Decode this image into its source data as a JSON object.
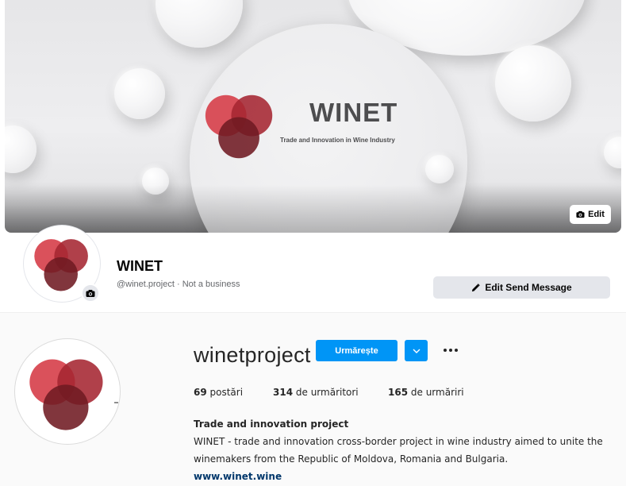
{
  "cover": {
    "title": "WINET",
    "tagline": "Trade and Innovation in Wine Industry",
    "edit_label": "Edit",
    "edit_icon": "camera-icon"
  },
  "facebook": {
    "name": "WINET",
    "subtitle": "@winet.project · Not a business",
    "edit_button_label": "Edit Send Message",
    "edit_button_icon": "pencil-icon",
    "avatar_camera_icon": "camera-icon"
  },
  "instagram": {
    "username": "winetproject",
    "follow_label": "Urmărește",
    "dropdown_icon": "chevron-down-icon",
    "more_icon": "more-dots-icon",
    "stats": [
      {
        "count": "69",
        "label": " postări"
      },
      {
        "count": "314",
        "label": " de urmăritori"
      },
      {
        "count": "165",
        "label": " de urmăriri"
      }
    ],
    "bio_title": "Trade and innovation project",
    "bio_lines": [
      "WINET - trade and innovation cross-border project in wine industry aimed to unite the",
      "winemakers from the Republic of Moldova, Romania and Bulgaria."
    ],
    "link": "www.winet.wine"
  },
  "colors": {
    "logo_red_light": "#d7424d",
    "logo_red_mid": "#a52531",
    "logo_red_dark": "#6f1a22",
    "instagram_blue": "#0095f6",
    "link_blue": "#00376b",
    "facebook_button_gray": "#e4e6eb"
  }
}
